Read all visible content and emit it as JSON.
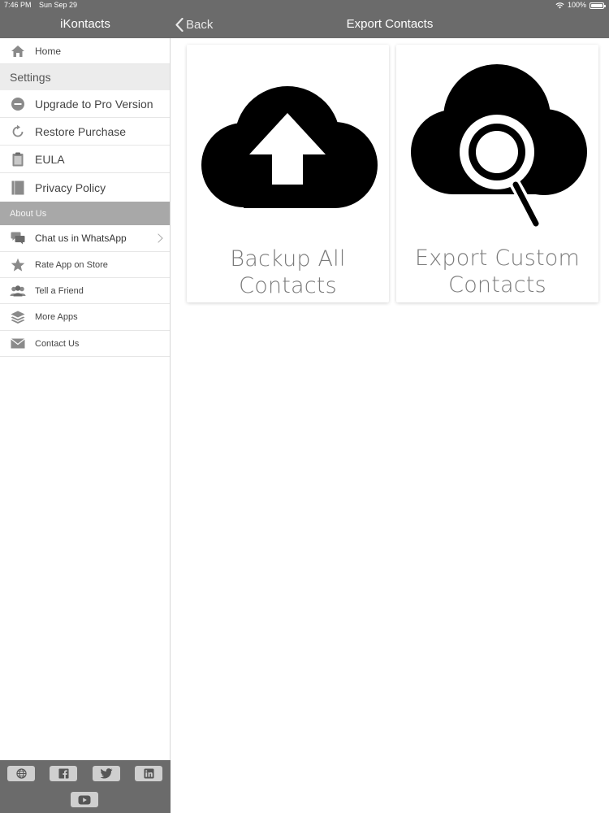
{
  "status_bar": {
    "time": "7:46 PM",
    "date": "Sun Sep 29",
    "battery": "100%"
  },
  "sidebar": {
    "title": "iKontacts",
    "home_label": "Home",
    "settings_header": "Settings",
    "settings_items": [
      {
        "label": "Upgrade to Pro Version",
        "icon": "minus-circle-icon"
      },
      {
        "label": "Restore Purchase",
        "icon": "refresh-icon"
      },
      {
        "label": "EULA",
        "icon": "clipboard-icon"
      },
      {
        "label": "Privacy Policy",
        "icon": "book-icon"
      }
    ],
    "about_header": "About Us",
    "about_items": [
      {
        "label": "Chat us in WhatsApp",
        "icon": "chat-bubbles-icon"
      },
      {
        "label": "Rate App on Store",
        "icon": "star-icon"
      },
      {
        "label": "Tell a Friend",
        "icon": "people-icon"
      },
      {
        "label": "More Apps",
        "icon": "layers-icon"
      },
      {
        "label": "Contact Us",
        "icon": "envelope-icon"
      }
    ],
    "social_icons": [
      "globe-icon",
      "facebook-icon",
      "twitter-icon",
      "linkedin-icon",
      "youtube-icon"
    ]
  },
  "navbar": {
    "back_label": "Back",
    "title": "Export Contacts"
  },
  "cards": [
    {
      "label": "Backup All Contacts",
      "icon": "cloud-upload-icon"
    },
    {
      "label_line1": "Export Custom",
      "label_line2": "Contacts",
      "icon": "cloud-search-icon"
    }
  ],
  "colors": {
    "bar": "#6b6b6b",
    "section_about": "#a8a8a8",
    "section_settings": "#ececec",
    "text_muted": "#7a7a7a"
  }
}
